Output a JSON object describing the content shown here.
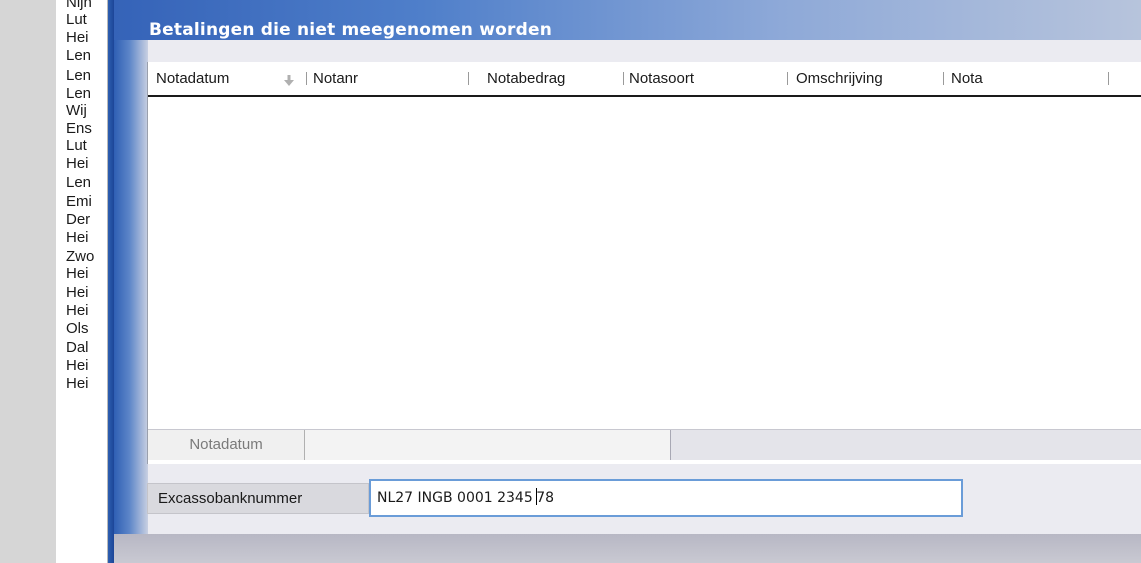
{
  "background_list": {
    "items": [
      "Nijn",
      "Lut",
      "Hei",
      "Len",
      "Len",
      "Len",
      "Wij",
      "Ens",
      "Lut",
      "Hei",
      "Len",
      "Emi",
      "Der",
      "Hei",
      "Zwo",
      "Hei",
      "Hei",
      "Hei",
      "Ols",
      "Dal",
      "Hei",
      "Hei"
    ]
  },
  "dialog": {
    "title": "Betalingen die niet meegenomen worden",
    "grid": {
      "columns": [
        "Notadatum",
        "Notanr",
        "Notabedrag",
        "Notasoort",
        "Omschrijving",
        "Nota"
      ],
      "sorted_column": "Notadatum",
      "sort_direction": "descending",
      "rows": [],
      "footer_label": "Notadatum",
      "footer_value": ""
    },
    "form": {
      "label": "Excassobanknummer",
      "value_before_caret": "NL27 INGB 0001 2345 ",
      "value_after_caret": "78"
    }
  },
  "colors": {
    "title_gradient_start": "#3563b8",
    "title_gradient_end": "#b7c4dc",
    "input_border": "#6a9cd8"
  }
}
